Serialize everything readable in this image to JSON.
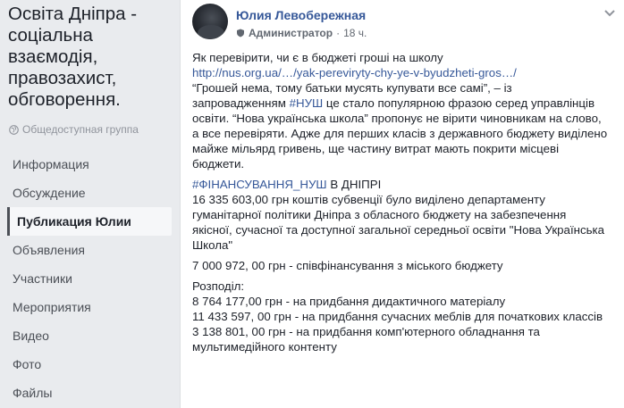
{
  "group": {
    "title": "Освіта Дніпра - соціальна взаємодія, правозахист, обговорення.",
    "type": "Общедоступная группа",
    "type_icon": "globe-icon"
  },
  "nav": [
    {
      "label": "Информация",
      "active": false
    },
    {
      "label": "Обсуждение",
      "active": false
    },
    {
      "label": "Публикация Юлии",
      "active": true
    },
    {
      "label": "Объявления",
      "active": false
    },
    {
      "label": "Участники",
      "active": false
    },
    {
      "label": "Мероприятия",
      "active": false
    },
    {
      "label": "Видео",
      "active": false
    },
    {
      "label": "Фото",
      "active": false
    },
    {
      "label": "Файлы",
      "active": false
    }
  ],
  "post": {
    "author": "Юлия Левобережная",
    "role": "Администратор",
    "separator": "·",
    "time": "18 ч.",
    "intro": "Як перевірити, чи є в бюджеті гроші на школу",
    "link": "http://nus.org.ua/…/yak-pereviryty-chy-ye-v-byudzheti-gros…/",
    "quote_before": "“Грошей нема, тому батьки мусять купувати все самі”, – із запровадженням ",
    "quote_tag": "#НУШ",
    "quote_after": " це стало популярною фразою серед управлінців освіти. “Нова українська школа” пропонує не вірити чиновникам на слово, а все перевіряти. Адже для перших класів з державного бюджету виділено майже мільярд гривень, ще частину витрат мають покрити місцеві бюджети.",
    "fin_tag": "#ФІНАНСУВАННЯ_НУШ",
    "fin_tag_rest": " В ДНІПРІ",
    "fin_text": "16 335 603,00 грн коштів субвенції було виділено департаменту гуманітарної політики Дніпра з обласного бюджету на забезпечення якісної, сучасної та доступної загальної середньої освіти \"Нова Українська Школа\"",
    "cofinance": "7 000 972, 00 грн - співфінансування з міського бюджету",
    "distribution_label": "Розподіл:",
    "dist_1": "8 764 177,00 грн - на придбання дидактичного матеріалу",
    "dist_2": "11 433 597, 00 грн - на придбання сучасних меблів для початкових классів",
    "dist_3": "3 138 801, 00 грн - на придбання комп'ютерного обладнання та мультимедійного контенту"
  },
  "colors": {
    "link": "#365899",
    "background": "#e9ebee",
    "text": "#1d2129",
    "muted": "#90949c"
  }
}
